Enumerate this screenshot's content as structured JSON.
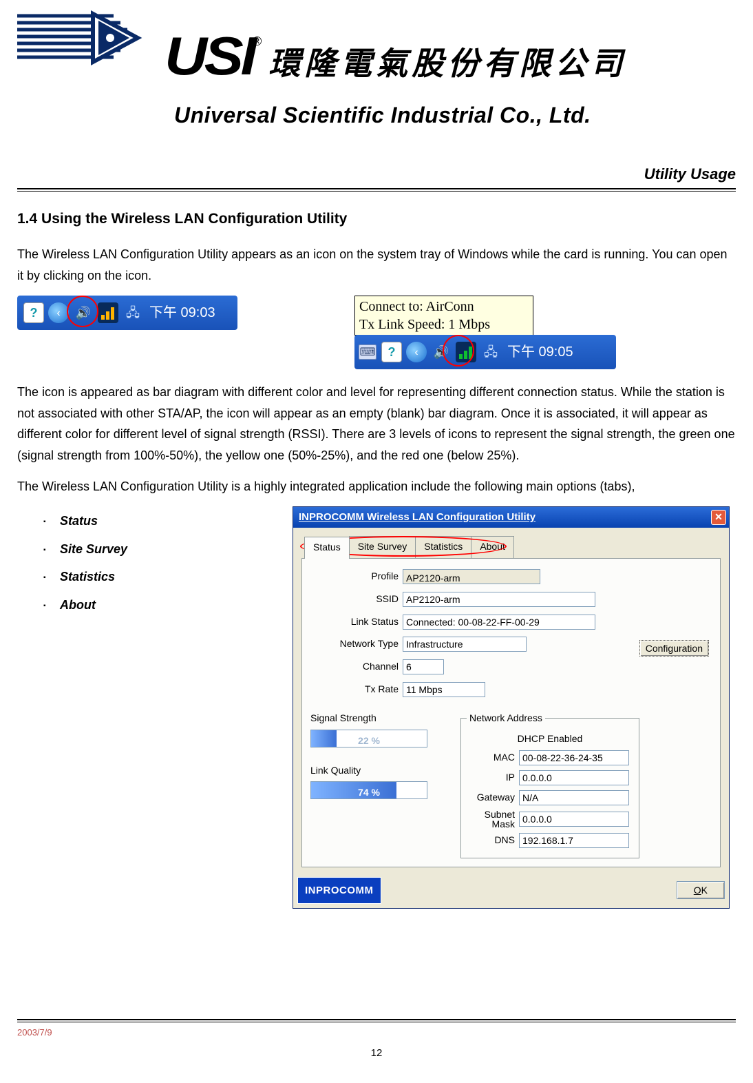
{
  "header": {
    "brand_acronym": "USI",
    "registered": "®",
    "cjk_name": "環隆電氣股份有限公司",
    "brand_full": "Universal Scientific Industrial Co., Ltd.",
    "chapter": "Utility Usage"
  },
  "section": {
    "heading": "1.4 Using the Wireless LAN Configuration Utility",
    "para1": "The Wireless LAN Configuration Utility appears as an icon on the system tray of Windows while the card is running. You can open it by clicking on the icon.",
    "systray_time_1": "下午 09:03",
    "tooltip_line1": "Connect to: AirConn",
    "tooltip_line2": "Tx Link Speed: 1 Mbps",
    "systray_time_2": "下午 09:05",
    "para2": "The icon is appeared as bar diagram with different color and level for representing different connection status. While the station is not associated with other STA/AP, the icon will appear as an empty (blank) bar diagram. Once it is associated, it will appear as different color for different level of signal strength (RSSI). There are 3 levels of icons to represent the signal strength, the green one (signal strength from 100%-50%), the yellow one (50%-25%), and the red one (below 25%).",
    "para3": "The Wireless LAN Configuration Utility is a highly integrated application include the following main options (tabs),"
  },
  "options": [
    "Status",
    "Site Survey",
    "Statistics",
    "About"
  ],
  "app": {
    "title": "INPROCOMM Wireless LAN Configuration Utility",
    "tabs": [
      "Status",
      "Site Survey",
      "Statistics",
      "About"
    ],
    "fields": {
      "profile_label": "Profile",
      "profile_value": "AP2120-arm",
      "ssid_label": "SSID",
      "ssid_value": "AP2120-arm",
      "linkstatus_label": "Link Status",
      "linkstatus_value": "Connected: 00-08-22-FF-00-29",
      "nettype_label": "Network Type",
      "nettype_value": "Infrastructure",
      "channel_label": "Channel",
      "channel_value": "6",
      "txrate_label": "Tx Rate",
      "txrate_value": "11 Mbps",
      "config_button": "Configuration"
    },
    "signal": {
      "label": "Signal Strength",
      "value_text": "22 %",
      "percent": 22
    },
    "quality": {
      "label": "Link Quality",
      "value_text": "74 %",
      "percent": 74
    },
    "netaddr": {
      "legend": "Network Address",
      "dhcp": "DHCP Enabled",
      "mac_label": "MAC",
      "mac_value": "00-08-22-36-24-35",
      "ip_label": "IP",
      "ip_value": "0.0.0.0",
      "gateway_label": "Gateway",
      "gateway_value": "N/A",
      "subnet_label": "Subnet Mask",
      "subnet_value": "0.0.0.0",
      "dns_label": "DNS",
      "dns_value": "192.168.1.7"
    },
    "brand": "INPROCOMM",
    "ok_prefix": "O",
    "ok_rest": "K"
  },
  "footer": {
    "date": "2003/7/9",
    "page": "12"
  }
}
